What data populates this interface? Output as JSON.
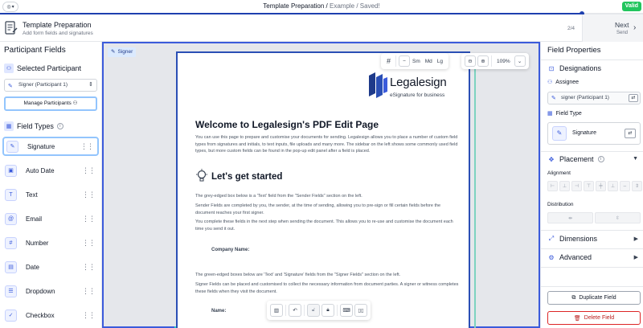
{
  "topbar": {
    "title_main": "Template Preparation /",
    "title_rest": " Example / Saved!",
    "status": "Valid",
    "progress": 0.905
  },
  "header": {
    "title": "Template Preparation",
    "subtitle": "Add form fields and signatures",
    "step": "2/4",
    "next_label": "Next",
    "next_sub": "Send"
  },
  "left": {
    "title": "Participant Fields",
    "selected_heading": "Selected Participant",
    "participant": "Signer (Participant 1)",
    "manage_label": "Manage Participants",
    "field_types_heading": "Field Types",
    "fields": [
      {
        "label": "Signature",
        "icon": "signature-icon"
      },
      {
        "label": "Auto Date",
        "icon": "calendar-auto-icon"
      },
      {
        "label": "Text",
        "icon": "text-icon"
      },
      {
        "label": "Email",
        "icon": "at-icon"
      },
      {
        "label": "Number",
        "icon": "hash-icon"
      },
      {
        "label": "Date",
        "icon": "calendar-icon"
      },
      {
        "label": "Dropdown",
        "icon": "list-icon"
      },
      {
        "label": "Checkbox",
        "icon": "checkbox-icon"
      }
    ]
  },
  "canvas": {
    "signer_tag": "Signer",
    "grid_sizes": [
      "Sm",
      "Md",
      "Lg"
    ],
    "zoom": "109%",
    "brand_name": "Legalesign",
    "brand_tagline": "eSignature for business",
    "heading": "Welcome to Legalesign's PDF Edit Page",
    "intro": "You can use this page to prepare and customise your documents for sending. Legalesign allows you to place a number of custom field types from signatures and initials, to text inputs, file uploads and many more. The sidebar on the left shows some commonly used field types, but more custom fields can be found in the pop-up edit panel after a field is placed.",
    "subheading": "Let's get started",
    "p1": "The grey-edged box below is a 'Text' field from the \"Sender Fields\" section on the left.",
    "p2": "Sender Fields are completed by you, the sender, at the time of sending, allowing you to pre-sign or fill certain fields before the document reaches your first signer.",
    "p3": "You complete these fields in the next step when sending the document. This allows you to re-use and customise the document each time you send it out.",
    "company_label": "Company Name:",
    "p4": "The green-edged boxes below are 'Text' and 'Signature' fields from the \"Signer Fields\" section on the left.",
    "p5": "Signer Fields can be placed and customised to collect the necessary information from document parties. A signer or witness completes these fields when they visit the document.",
    "name_label": "Name:"
  },
  "right": {
    "title": "Field Properties",
    "designations": "Designations",
    "assignee_label": "Assignee",
    "assignee_value": "signer (Participant 1)",
    "field_type_label": "Field Type",
    "field_type_value": "Signature",
    "placement": "Placement",
    "alignment": "Alignment",
    "distribution": "Distribution",
    "dimensions": "Dimensions",
    "advanced": "Advanced",
    "duplicate": "Duplicate Field",
    "delete": "Delete Field"
  },
  "colors": {
    "accent": "#3b5bdb",
    "valid": "#22c55e",
    "danger": "#dc2626"
  }
}
